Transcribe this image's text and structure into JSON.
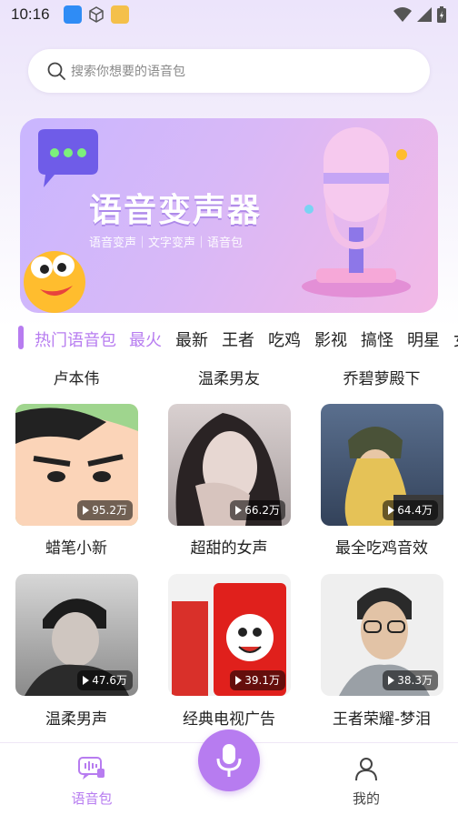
{
  "status_bar": {
    "time": "10:16"
  },
  "search": {
    "placeholder": "搜索你想要的语音包"
  },
  "banner": {
    "title": "语音变声器",
    "subtitle": "语音变声｜文字变声｜语音包"
  },
  "tabs": [
    "热门语音包",
    "最火",
    "最新",
    "王者",
    "吃鸡",
    "影视",
    "搞怪",
    "明星",
    "女"
  ],
  "active_tabs": [
    "热门语音包",
    "最火"
  ],
  "top_row_labels": [
    "卢本伟",
    "温柔男友",
    "乔碧萝殿下"
  ],
  "cards": [
    {
      "title": "蜡笔小新",
      "plays": "95.2万"
    },
    {
      "title": "超甜的女声",
      "plays": "66.2万"
    },
    {
      "title": "最全吃鸡音效",
      "plays": "64.4万"
    },
    {
      "title": "温柔男声",
      "plays": "47.6万"
    },
    {
      "title": "经典电视广告",
      "plays": "39.1万"
    },
    {
      "title": "王者荣耀-梦泪",
      "plays": "38.3万"
    }
  ],
  "nav": {
    "voice_pack_label": "语音包",
    "mine_label": "我的"
  },
  "colors": {
    "accent": "#b77cf0",
    "text": "#222222"
  }
}
